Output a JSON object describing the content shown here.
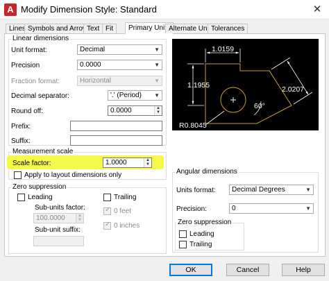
{
  "window": {
    "title": "Modify Dimension Style: Standard",
    "close_glyph": "✕",
    "icon": "autocad-app-icon"
  },
  "tabs": [
    "Lines",
    "Symbols and Arrows",
    "Text",
    "Fit",
    "Primary Units",
    "Alternate Units",
    "Tolerances"
  ],
  "active_tab": "Primary Units",
  "linear": {
    "legend": "Linear dimensions",
    "unit_format_label": "Unit format:",
    "unit_format_value": "Decimal",
    "precision_label": "Precision",
    "precision_value": "0.0000",
    "fraction_format_label": "Fraction format:",
    "fraction_format_value": "Horizontal",
    "decimal_separator_label": "Decimal separator:",
    "decimal_separator_value": "'.' (Period)",
    "round_off_label": "Round off:",
    "round_off_value": "0.0000",
    "prefix_label": "Prefix:",
    "prefix_value": "",
    "suffix_label": "Suffix:",
    "suffix_value": ""
  },
  "measurement": {
    "legend": "Measurement scale",
    "scale_factor_label": "Scale factor:",
    "scale_factor_value": "1.0000",
    "apply_layout_label": "Apply to layout dimensions only",
    "highlight_color": "#f4f84a"
  },
  "zero_left": {
    "legend": "Zero suppression",
    "leading_label": "Leading",
    "trailing_label": "Trailing",
    "sub_units_factor_label": "Sub-units factor:",
    "sub_units_factor_value": "100.0000",
    "zero_feet_label": "0 feet",
    "zero_inches_label": "0 inches",
    "sub_unit_suffix_label": "Sub-unit suffix:",
    "sub_unit_suffix_value": ""
  },
  "preview": {
    "dim_top": "1.0159",
    "dim_left": "1.1955",
    "dim_right": "2.0207",
    "angle": "60°",
    "radius": "R0.8045",
    "line_color": "#ffffff",
    "shape_color": "#c8a03c"
  },
  "angular": {
    "legend": "Angular dimensions",
    "units_format_label": "Units format:",
    "units_format_value": "Decimal Degrees",
    "precision_label": "Precision:",
    "precision_value": "0",
    "zero_legend": "Zero suppression",
    "leading_label": "Leading",
    "trailing_label": "Trailing"
  },
  "buttons": {
    "ok": "OK",
    "cancel": "Cancel",
    "help": "Help"
  }
}
